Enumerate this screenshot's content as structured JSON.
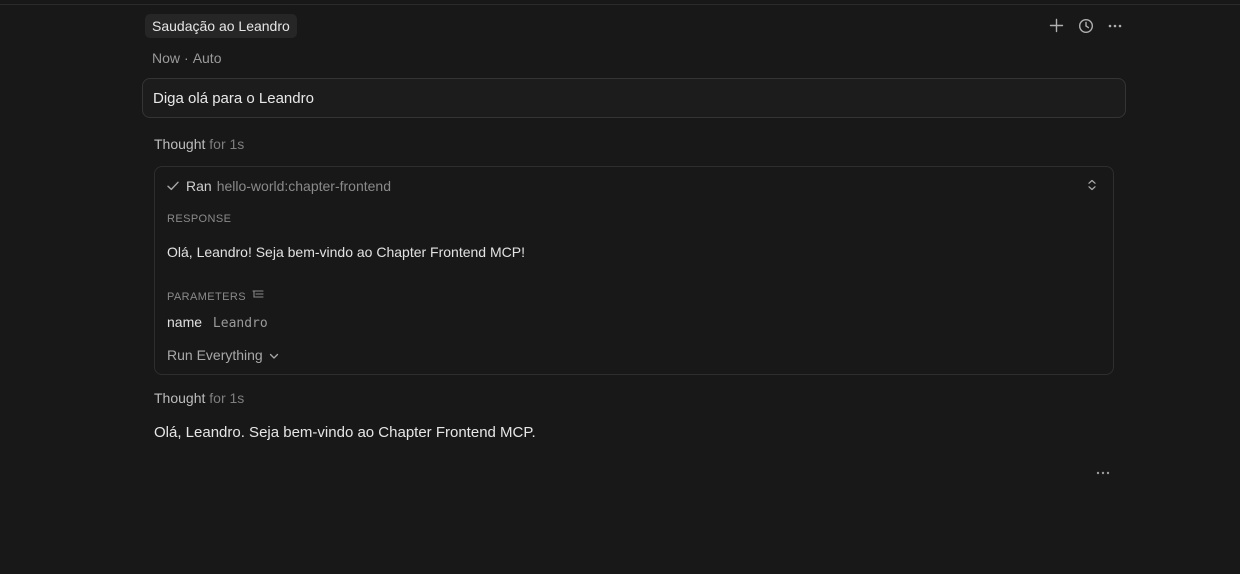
{
  "header": {
    "title": "Saudação ao Leandro",
    "icons": [
      "plus-icon",
      "history-icon",
      "more-icon"
    ]
  },
  "meta": {
    "time": "Now",
    "separator": "·",
    "mode": "Auto"
  },
  "prompt": {
    "text": "Diga olá para o Leandro"
  },
  "thought1": {
    "label": "Thought",
    "duration": "for 1s"
  },
  "tool_call": {
    "status_icon": "check-icon",
    "status": "Ran",
    "name": "hello-world:chapter-frontend",
    "response_label": "RESPONSE",
    "response": "Olá, Leandro! Seja bem-vindo ao Chapter Frontend MCP!",
    "parameters_label": "PARAMETERS",
    "parameters": [
      {
        "key": "name",
        "value": "Leandro"
      }
    ],
    "run_label": "Run Everything"
  },
  "thought2": {
    "label": "Thought",
    "duration": "for 1s"
  },
  "answer": {
    "text": "Olá, Leandro. Seja bem-vindo ao Chapter Frontend MCP."
  }
}
